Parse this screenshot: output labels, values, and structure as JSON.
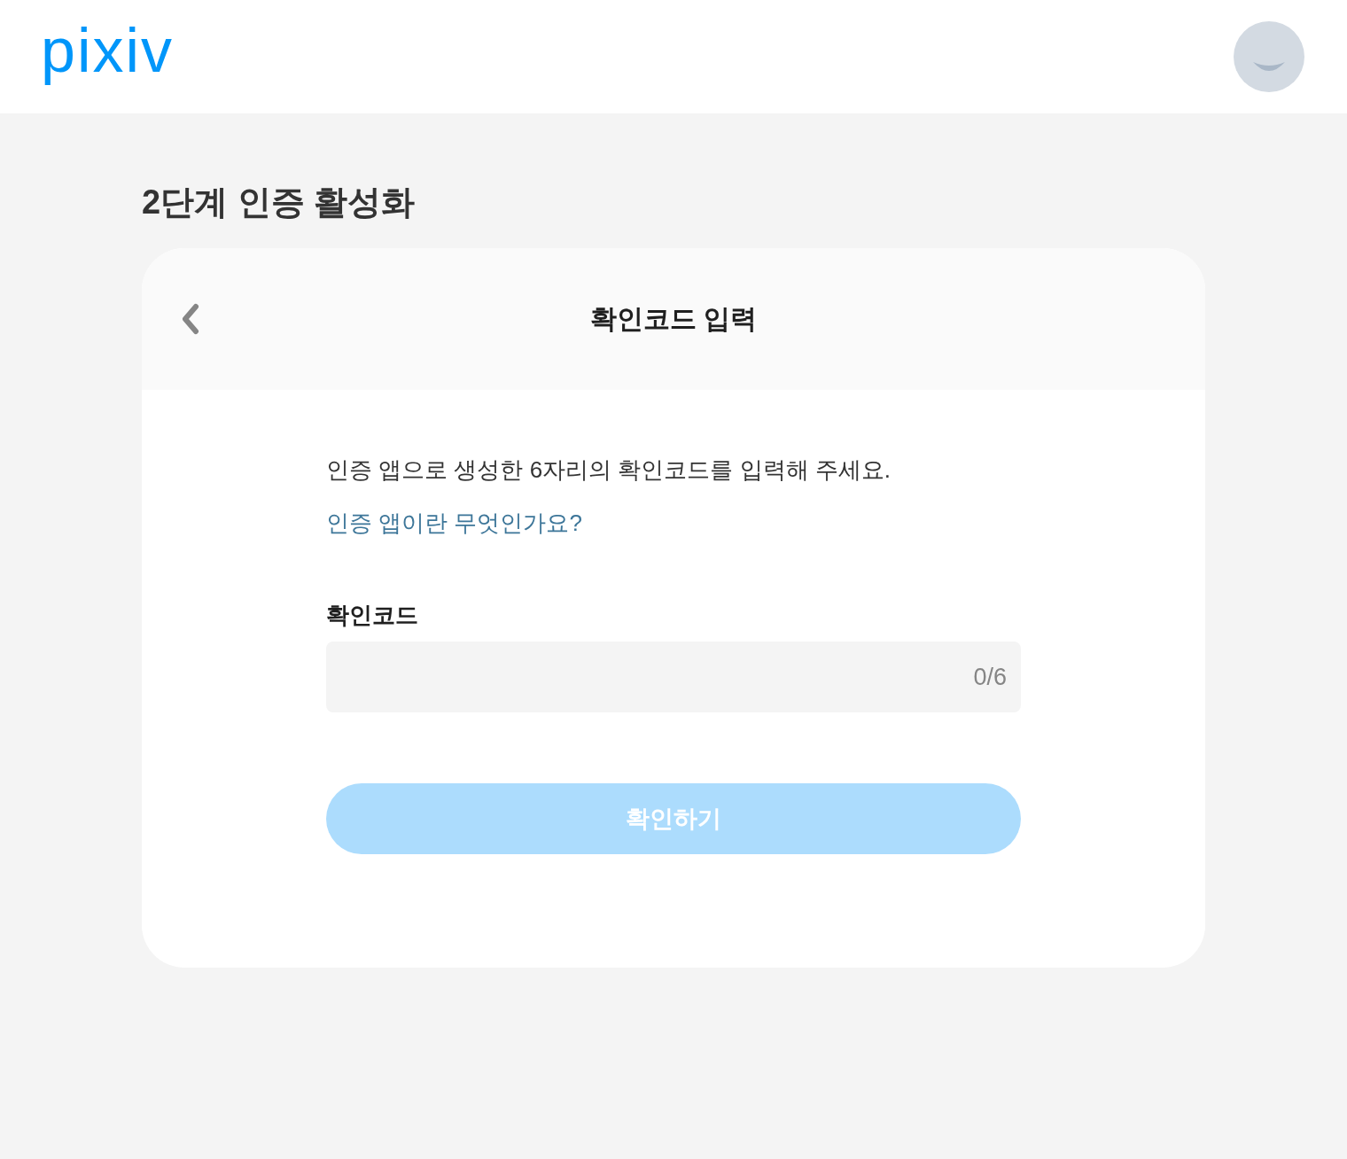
{
  "header": {
    "logo": "pixiv"
  },
  "page": {
    "title": "2단계 인증 활성화"
  },
  "card": {
    "title": "확인코드 입력",
    "description": "인증 앱으로 생성한 6자리의 확인코드를 입력해 주세요.",
    "help_link": "인증 앱이란 무엇인가요?",
    "field": {
      "label": "확인코드",
      "counter": "0/6"
    },
    "button": {
      "label": "확인하기",
      "disabled": true
    }
  }
}
